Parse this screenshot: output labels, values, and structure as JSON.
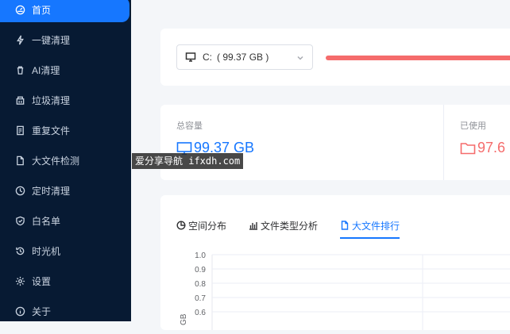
{
  "sidebar": {
    "items": [
      {
        "label": "首页",
        "icon": "gauge-icon",
        "active": true
      },
      {
        "label": "一键清理",
        "icon": "lightning-icon"
      },
      {
        "label": "AI清理",
        "icon": "trash-icon"
      },
      {
        "label": "垃圾清理",
        "icon": "bin-icon"
      },
      {
        "label": "重复文件",
        "icon": "copy-file-icon"
      },
      {
        "label": "大文件检测",
        "icon": "file-icon"
      },
      {
        "label": "定时清理",
        "icon": "clock-icon"
      },
      {
        "label": "白名单",
        "icon": "shield-icon"
      },
      {
        "label": "时光机",
        "icon": "history-icon"
      },
      {
        "label": "设置",
        "icon": "gear-icon"
      },
      {
        "label": "关于",
        "icon": "info-icon"
      }
    ]
  },
  "watermark": "爱分享导航 ifxdh.com",
  "drive": {
    "prefix": "C:",
    "size_text": "( 99.37 GB )",
    "usage_fraction": 0.98
  },
  "stats": {
    "total_label": "总容量",
    "total_value": "99.37 GB",
    "used_label": "已使用",
    "used_value": "97.6"
  },
  "tabs": [
    {
      "label": "空间分布",
      "icon": "pie-icon"
    },
    {
      "label": "文件类型分析",
      "icon": "bar-chart-icon"
    },
    {
      "label": "大文件排行",
      "icon": "document-icon",
      "active": true
    }
  ],
  "chart_data": {
    "type": "bar",
    "title": "",
    "xlabel": "",
    "ylabel": "GB",
    "yticks": [
      "1.0",
      "0.9",
      "0.8",
      "0.7",
      "0.6"
    ],
    "ylim": [
      0,
      1
    ],
    "grid": true,
    "categories": [],
    "values": []
  },
  "colors": {
    "sidebar_bg": "#071a33",
    "accent": "#1677ff",
    "danger": "#f56c6c"
  }
}
